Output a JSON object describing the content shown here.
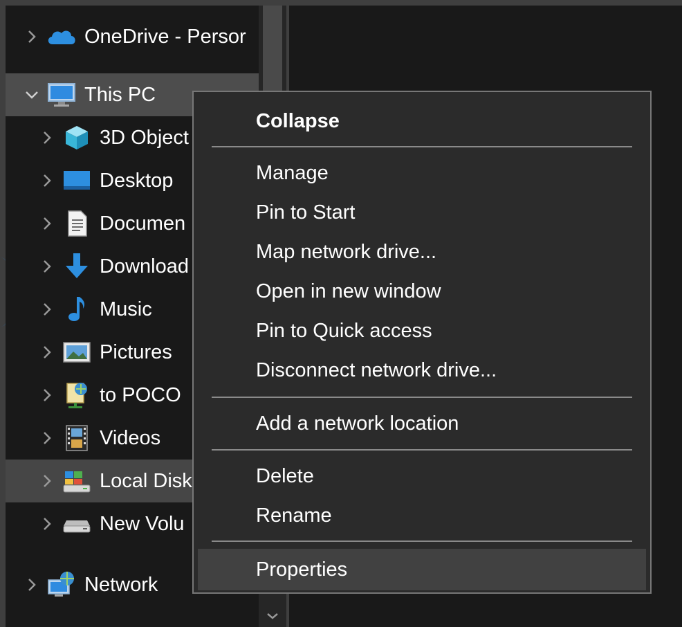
{
  "nav_tree": {
    "items": [
      {
        "label": "OneDrive - Persor",
        "icon": "cloud-icon"
      },
      {
        "label": "This PC",
        "icon": "monitor-icon"
      },
      {
        "label": "3D Object",
        "icon": "cube-icon"
      },
      {
        "label": "Desktop",
        "icon": "desktop-icon"
      },
      {
        "label": "Documen",
        "icon": "document-icon"
      },
      {
        "label": "Download",
        "icon": "download-arrow-icon"
      },
      {
        "label": "Music",
        "icon": "music-note-icon"
      },
      {
        "label": "Pictures",
        "icon": "picture-icon"
      },
      {
        "label": "to POCO",
        "icon": "network-share-icon"
      },
      {
        "label": "Videos",
        "icon": "film-icon"
      },
      {
        "label": "Local Disk",
        "icon": "local-disk-icon"
      },
      {
        "label": "New Volu",
        "icon": "drive-icon"
      },
      {
        "label": "Network",
        "icon": "network-icon"
      }
    ]
  },
  "context_menu": {
    "items": [
      {
        "label": "Collapse"
      },
      {
        "label": "Manage"
      },
      {
        "label": "Pin to Start"
      },
      {
        "label": "Map network drive..."
      },
      {
        "label": "Open in new window"
      },
      {
        "label": "Pin to Quick access"
      },
      {
        "label": "Disconnect network drive..."
      },
      {
        "label": "Add a network location"
      },
      {
        "label": "Delete"
      },
      {
        "label": "Rename"
      },
      {
        "label": "Properties"
      }
    ]
  },
  "colors": {
    "background": "#191919",
    "selected_row": "#4d4d4d",
    "menu_background": "#2b2b2b",
    "menu_border": "#777777",
    "accent_blue": "#2d8fe0"
  }
}
